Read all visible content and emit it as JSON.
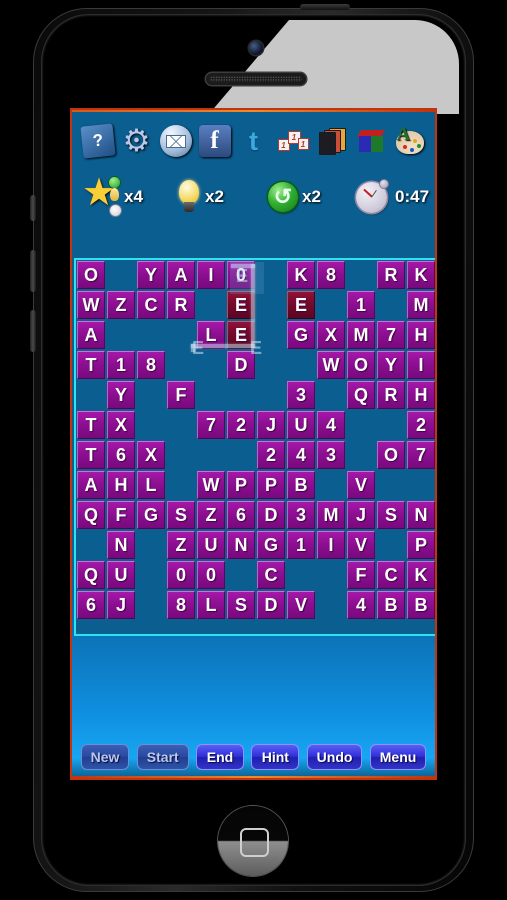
{
  "toolbar": {
    "icons": [
      {
        "name": "help-icon",
        "label": "?"
      },
      {
        "name": "settings-gear-icon",
        "label": "⚙"
      },
      {
        "name": "mail-icon",
        "label": "mail"
      },
      {
        "name": "facebook-icon",
        "label": "f"
      },
      {
        "name": "twitter-icon",
        "label": "t"
      },
      {
        "name": "dice-icon",
        "label": "dice"
      },
      {
        "name": "cards-icon",
        "label": "cards"
      },
      {
        "name": "cube-icon",
        "label": "cube"
      },
      {
        "name": "palette-icon",
        "label": "A"
      }
    ]
  },
  "status": {
    "star_count": "x4",
    "hint_count": "x2",
    "undo_count": "x2",
    "timer": "0:47"
  },
  "board": {
    "rows": 13,
    "cols": 12,
    "colors": {
      "tile": "#8d0f92",
      "tile_highlight": "#75092c",
      "board_border": "#2ee3f0",
      "screen_bg": "#0b5e90",
      "screen_border": "#c0340f"
    },
    "grid": [
      [
        "O",
        "",
        "Y",
        "A",
        "I",
        "0",
        "",
        "K",
        "8",
        "",
        "R",
        "K"
      ],
      [
        "W",
        "Z",
        "C",
        "R",
        "",
        "E",
        "",
        "E",
        "",
        "1",
        "",
        "M"
      ],
      [
        "A",
        "",
        "",
        "",
        "L",
        "E",
        "",
        "G",
        "X",
        "M",
        "7",
        "H"
      ],
      [
        "T",
        "1",
        "8",
        "",
        "",
        "D",
        "",
        "",
        "W",
        "O",
        "Y",
        "I"
      ],
      [
        "",
        "Y",
        "",
        "F",
        "",
        "",
        "",
        "3",
        "",
        "Q",
        "R",
        "H"
      ],
      [
        "T",
        "X",
        "",
        "",
        "7",
        "2",
        "J",
        "U",
        "4",
        "",
        "",
        "2"
      ],
      [
        "T",
        "6",
        "X",
        "",
        "",
        "",
        "2",
        "4",
        "3",
        "",
        "O",
        "7"
      ],
      [
        "A",
        "H",
        "L",
        "",
        "W",
        "P",
        "P",
        "B",
        "",
        "V",
        "",
        ""
      ],
      [
        "Q",
        "F",
        "G",
        "S",
        "Z",
        "6",
        "D",
        "3",
        "M",
        "J",
        "S",
        "N"
      ],
      [
        "",
        "N",
        "",
        "Z",
        "U",
        "N",
        "G",
        "1",
        "I",
        "V",
        "",
        "P"
      ],
      [
        "Q",
        "U",
        "",
        "0",
        "0",
        "",
        "C",
        "",
        "",
        "F",
        "C",
        "K"
      ],
      [
        "6",
        "J",
        "",
        "8",
        "L",
        "S",
        "D",
        "V",
        "",
        "4",
        "B",
        "B"
      ]
    ],
    "highlighted": [
      [
        1,
        5
      ],
      [
        1,
        7
      ],
      [
        2,
        5
      ]
    ],
    "selection_path_letters": [
      "E",
      "E",
      "E",
      "E"
    ]
  },
  "buttons": [
    {
      "name": "new-button",
      "label": "New",
      "state": "dim"
    },
    {
      "name": "start-button",
      "label": "Start",
      "state": "dim"
    },
    {
      "name": "end-button",
      "label": "End",
      "state": "active"
    },
    {
      "name": "hint-button",
      "label": "Hint",
      "state": "active"
    },
    {
      "name": "undo-button",
      "label": "Undo",
      "state": "active"
    },
    {
      "name": "menu-button",
      "label": "Menu",
      "state": "active"
    }
  ]
}
